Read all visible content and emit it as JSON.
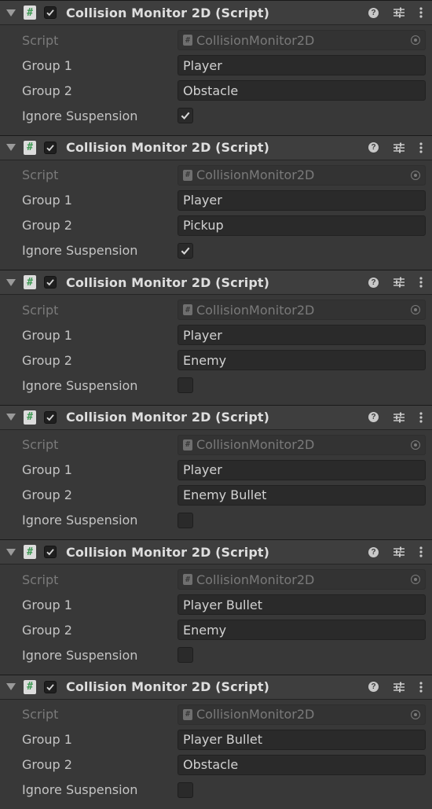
{
  "components": [
    {
      "title": "Collision Monitor 2D (Script)",
      "enabled": true,
      "script_label": "Script",
      "script_value": "CollisionMonitor2D",
      "group1_label": "Group 1",
      "group1": "Player",
      "group2_label": "Group 2",
      "group2": "Obstacle",
      "ignore_label": "Ignore Suspension",
      "ignore_suspension": true
    },
    {
      "title": "Collision Monitor 2D (Script)",
      "enabled": true,
      "script_label": "Script",
      "script_value": "CollisionMonitor2D",
      "group1_label": "Group 1",
      "group1": "Player",
      "group2_label": "Group 2",
      "group2": "Pickup",
      "ignore_label": "Ignore Suspension",
      "ignore_suspension": true
    },
    {
      "title": "Collision Monitor 2D (Script)",
      "enabled": true,
      "script_label": "Script",
      "script_value": "CollisionMonitor2D",
      "group1_label": "Group 1",
      "group1": "Player",
      "group2_label": "Group 2",
      "group2": "Enemy",
      "ignore_label": "Ignore Suspension",
      "ignore_suspension": false
    },
    {
      "title": "Collision Monitor 2D (Script)",
      "enabled": true,
      "script_label": "Script",
      "script_value": "CollisionMonitor2D",
      "group1_label": "Group 1",
      "group1": "Player",
      "group2_label": "Group 2",
      "group2": "Enemy Bullet",
      "ignore_label": "Ignore Suspension",
      "ignore_suspension": false
    },
    {
      "title": "Collision Monitor 2D (Script)",
      "enabled": true,
      "script_label": "Script",
      "script_value": "CollisionMonitor2D",
      "group1_label": "Group 1",
      "group1": "Player Bullet",
      "group2_label": "Group 2",
      "group2": "Enemy",
      "ignore_label": "Ignore Suspension",
      "ignore_suspension": false
    },
    {
      "title": "Collision Monitor 2D (Script)",
      "enabled": true,
      "script_label": "Script",
      "script_value": "CollisionMonitor2D",
      "group1_label": "Group 1",
      "group1": "Player Bullet",
      "group2_label": "Group 2",
      "group2": "Obstacle",
      "ignore_label": "Ignore Suspension",
      "ignore_suspension": false
    }
  ],
  "icons": {
    "script": "#",
    "help": "?"
  },
  "colors": {
    "script_icon_glyph": "#3f9a55",
    "panel": "#383838",
    "header": "#3e3e3e",
    "field": "#2a2a2a"
  }
}
